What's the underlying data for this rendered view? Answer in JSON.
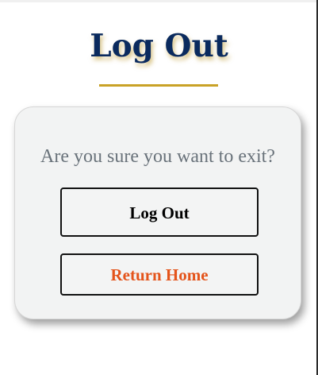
{
  "page": {
    "title": "Log Out"
  },
  "dialog": {
    "prompt": "Are you sure you want to exit?",
    "logout_label": "Log Out",
    "home_label": "Return Home"
  },
  "colors": {
    "title": "#0a2a5e",
    "title_shadow": "#b58c18",
    "rule": "#c9a227",
    "home_text": "#e4541b",
    "prompt_text": "#69727a"
  }
}
